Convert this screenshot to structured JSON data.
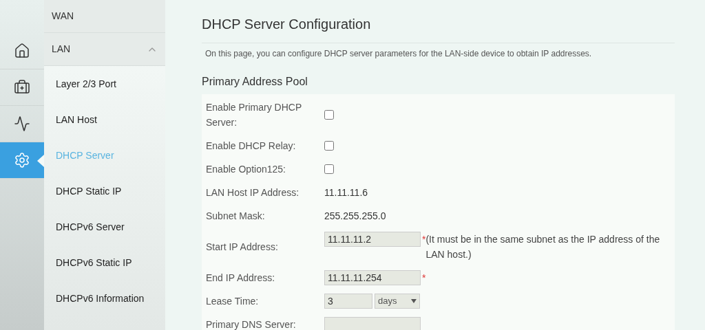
{
  "rail": [
    {
      "kind": "home",
      "selected": false
    },
    {
      "kind": "kit",
      "selected": false
    },
    {
      "kind": "pulse",
      "selected": false
    },
    {
      "kind": "gear",
      "selected": true
    }
  ],
  "menu": {
    "groups": [
      {
        "label": "WAN"
      },
      {
        "label": "LAN",
        "expanded": true,
        "children": [
          {
            "label": "Layer 2/3 Port",
            "selected": false
          },
          {
            "label": "LAN Host",
            "selected": false
          },
          {
            "label": "DHCP Server",
            "selected": true
          },
          {
            "label": "DHCP Static IP",
            "selected": false
          },
          {
            "label": "DHCPv6 Server",
            "selected": false
          },
          {
            "label": "DHCPv6 Static IP",
            "selected": false
          },
          {
            "label": "DHCPv6 Information",
            "selected": false
          }
        ]
      }
    ]
  },
  "page": {
    "title": "DHCP Server Configuration",
    "description": "On this page, you can configure DHCP server parameters for the LAN-side device to obtain IP addresses.",
    "section": "Primary Address Pool"
  },
  "form": [
    {
      "kind": "checkbox",
      "label": "Enable Primary DHCP Server:",
      "checked": false
    },
    {
      "kind": "checkbox",
      "label": "Enable DHCP Relay:",
      "checked": false
    },
    {
      "kind": "checkbox",
      "label": "Enable Option125:",
      "checked": false
    },
    {
      "kind": "text",
      "label": "LAN Host IP Address:",
      "value": "11.11.11.6"
    },
    {
      "kind": "text",
      "label": "Subnet Mask:",
      "value": "255.255.255.0"
    },
    {
      "kind": "input",
      "label": "Start IP Address:",
      "value": "11.11.11.2",
      "required": "*",
      "note": "(It must be in the same subnet as the IP address of the LAN host.)"
    },
    {
      "kind": "input",
      "label": "End IP Address:",
      "value": "11.11.11.254",
      "required": "*"
    },
    {
      "kind": "duration",
      "label": "Lease Time:",
      "value": "3",
      "unit": "days"
    },
    {
      "kind": "input",
      "label": "Primary DNS Server:"
    }
  ]
}
